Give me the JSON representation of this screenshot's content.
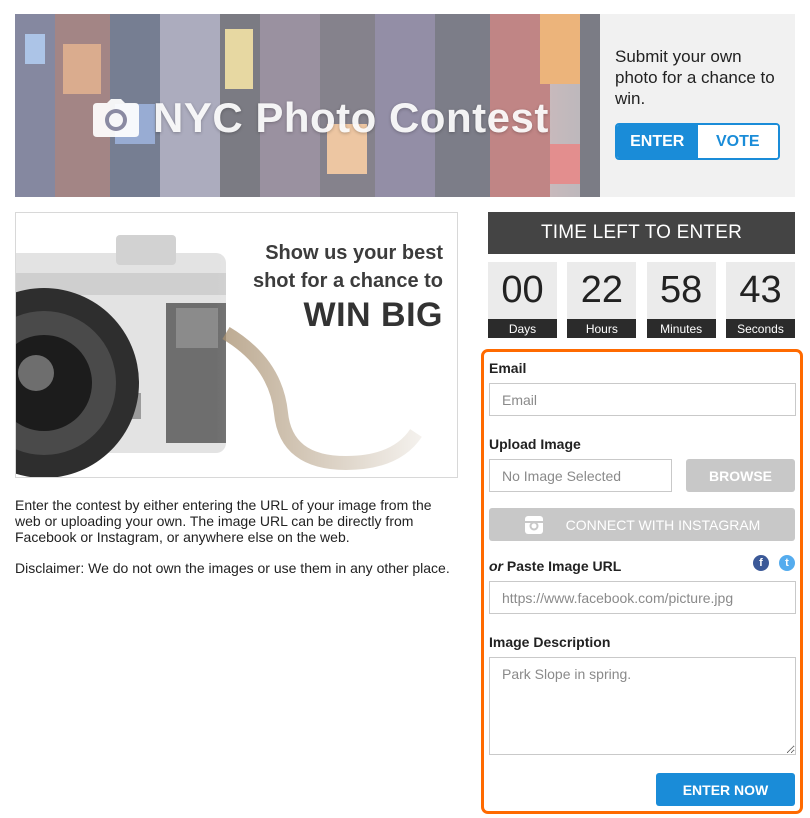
{
  "banner": {
    "title": "NYC Photo Contest"
  },
  "promo": {
    "text": "Submit your own photo for a chance to win.",
    "tabs": [
      {
        "label": "ENTER",
        "active": true
      },
      {
        "label": "VOTE",
        "active": false
      }
    ]
  },
  "hero": {
    "line1": "Show us your best",
    "line2": "shot for a chance to",
    "line3": "WIN BIG"
  },
  "description": {
    "paragraph1": "Enter the contest by either entering the URL of your image from the web or uploading your own. The image URL can be directly from Facebook or Instagram, or anywhere else on the web.",
    "paragraph2": "Disclaimer: We do not own the images or use them in any other place."
  },
  "countdown": {
    "heading": "TIME LEFT TO ENTER",
    "units": [
      {
        "value": "00",
        "label": "Days"
      },
      {
        "value": "22",
        "label": "Hours"
      },
      {
        "value": "58",
        "label": "Minutes"
      },
      {
        "value": "43",
        "label": "Seconds"
      }
    ]
  },
  "form": {
    "email_label": "Email",
    "email_placeholder": "Email",
    "upload_label": "Upload Image",
    "upload_placeholder": "No Image Selected",
    "browse_label": "BROWSE",
    "instagram_label": "CONNECT WITH INSTAGRAM",
    "url_label_prefix": "or",
    "url_label": "Paste Image URL",
    "url_placeholder": "https://www.facebook.com/picture.jpg",
    "desc_label": "Image Description",
    "desc_placeholder": "Park Slope in spring.",
    "submit_label": "ENTER NOW"
  },
  "colors": {
    "accent": "#1a8cd8",
    "highlight_border": "#ff6a00",
    "countdown_dark": "#444444",
    "button_gray": "#c8c8c8",
    "facebook": "#3b5998",
    "twitter": "#55acee"
  },
  "icons": {
    "banner": "camera-icon",
    "instagram": "instagram-icon",
    "facebook": "facebook-icon",
    "twitter": "twitter-icon"
  }
}
